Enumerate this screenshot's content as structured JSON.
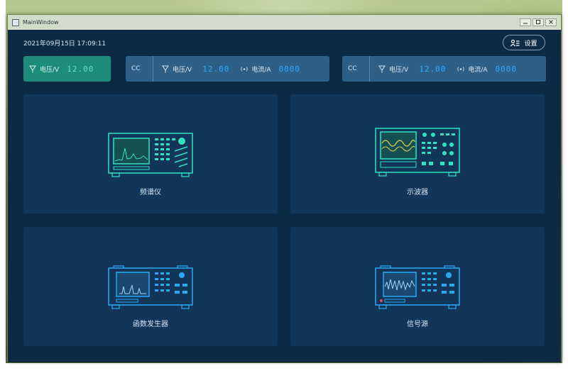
{
  "window": {
    "title": "MainWindow",
    "controls": [
      "minimize-button",
      "maximize-button",
      "close-button"
    ]
  },
  "header": {
    "datetime": "2021年09月15日 17:09:11",
    "settings_label": "设置"
  },
  "status": {
    "main": {
      "voltage_label": "电压/V",
      "voltage_value": "12.00"
    },
    "channels": [
      {
        "mode": "CC",
        "voltage_label": "电压/V",
        "voltage_value": "12.00",
        "current_label": "电流/A",
        "current_value": "0000"
      },
      {
        "mode": "CC",
        "voltage_label": "电压/V",
        "voltage_value": "12.00",
        "current_label": "电流/A",
        "current_value": "0000"
      }
    ]
  },
  "instruments": [
    {
      "label": "频谱仪",
      "icon": "spectrum-analyzer-icon",
      "color": "#2fe3c0"
    },
    {
      "label": "示波器",
      "icon": "oscilloscope-icon",
      "color": "#2fe3c0"
    },
    {
      "label": "函数发生器",
      "icon": "function-generator-icon",
      "color": "#2aa9f0"
    },
    {
      "label": "信号源",
      "icon": "signal-source-icon",
      "color": "#2aa9f0"
    }
  ]
}
